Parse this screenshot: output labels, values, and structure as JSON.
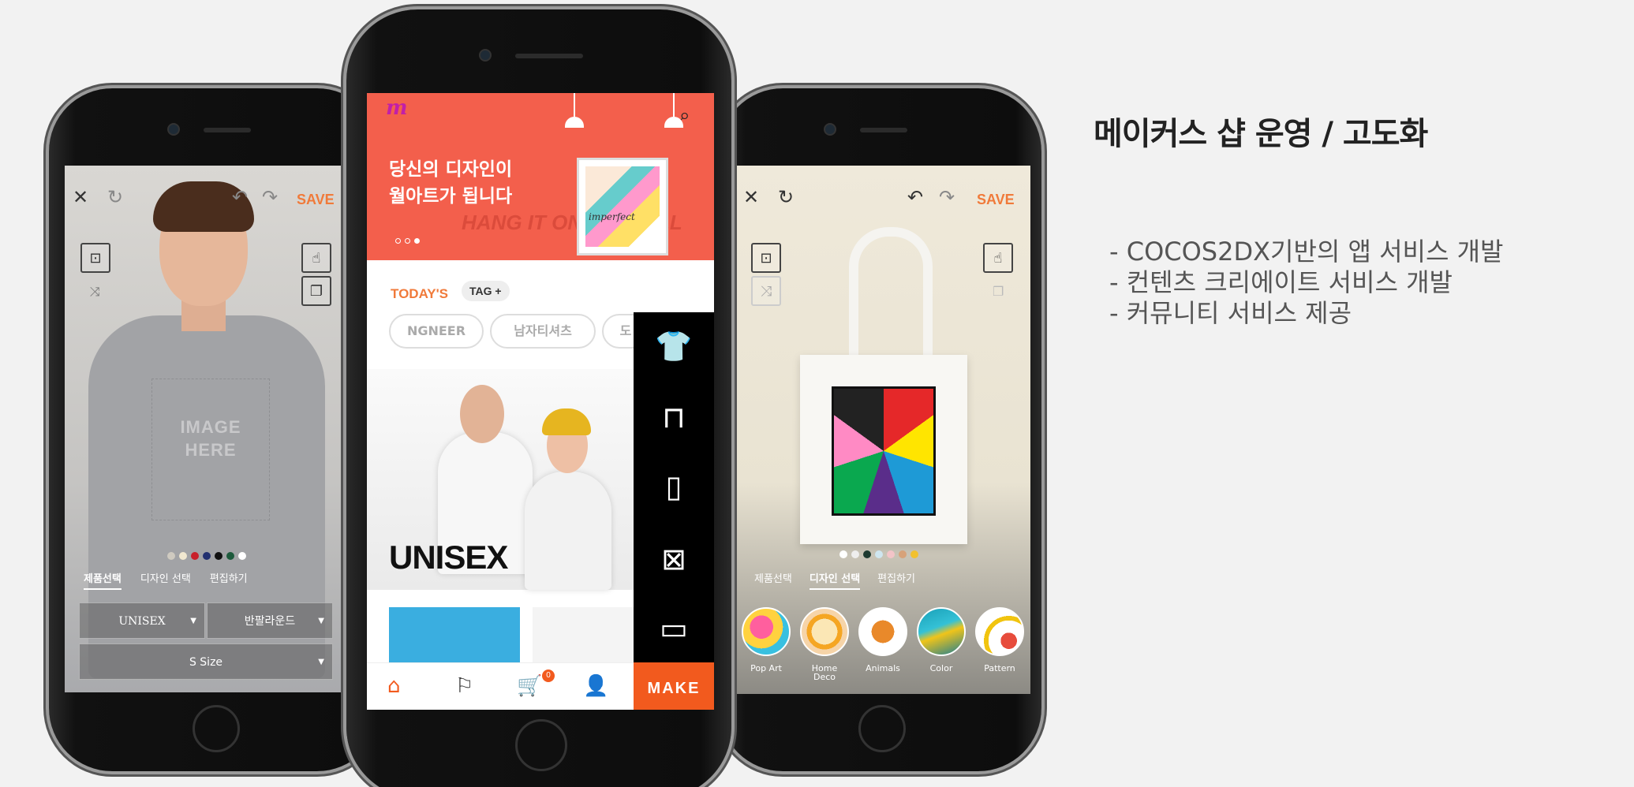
{
  "left_phone": {
    "save_label": "SAVE",
    "image_placeholder": "IMAGE\nHERE",
    "tabs": [
      "제품선택",
      "디자인 선택",
      "편집하기"
    ],
    "dropdown_type": "UNISEX",
    "dropdown_neck": "반팔라운드",
    "dropdown_size": "S Size",
    "swatches": [
      "#cfcac0",
      "#f1e8d0",
      "#c8202a",
      "#223070",
      "#111111",
      "#1d5a3c",
      "#ffffff"
    ]
  },
  "center_phone": {
    "banner_title_line1": "당신의 디자인이",
    "banner_title_line2": "월아트가 됩니다",
    "banner_watermark": "HANG IT ON MY WALL",
    "frame_text": "imperfect",
    "todays_label": "TODAY'S",
    "tag_label": "TAG +",
    "pills": [
      "NGNEER",
      "남자티셔츠",
      "도"
    ],
    "hero_text": "UNISEX",
    "cart_count": "0",
    "make_label": "MAKE"
  },
  "right_phone": {
    "save_label": "SAVE",
    "tabs": [
      "제품선택",
      "디자인 선택",
      "편집하기"
    ],
    "categories": [
      "Pop Art",
      "Home Deco",
      "Animals",
      "Color",
      "Pattern"
    ],
    "swatches": [
      "#ffffff",
      "#eeeeee",
      "#1d3a30",
      "#cfe6f0",
      "#f3c4c8",
      "#d7a27a",
      "#f2c12e"
    ]
  },
  "headline": "메이커스 샵 운영 / 고도화",
  "bullets": [
    "COCOS2DX기반의 앱 서비스 개발",
    "컨텐츠 크리에이트 서비스 개발",
    "커뮤니티 서비스 제공"
  ]
}
